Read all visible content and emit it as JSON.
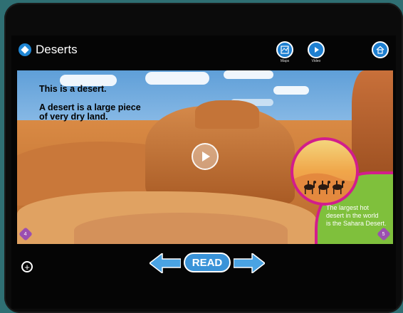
{
  "header": {
    "title": "Deserts",
    "maps_label": "Maps",
    "video_label": "Video"
  },
  "page": {
    "line1": "This is a desert.",
    "line2a": "A desert is a large piece",
    "line2b": "of very dry land.",
    "caption_line1": "The largest hot",
    "caption_line2": "desert in the world",
    "caption_line3": "is the Sahara Desert.",
    "page_left": "4",
    "page_right": "5"
  },
  "footer": {
    "read_label": "READ",
    "add_symbol": "+"
  },
  "colors": {
    "accent_blue": "#1e7fd0",
    "magenta": "#d21d8c",
    "green": "#7fc03c"
  }
}
